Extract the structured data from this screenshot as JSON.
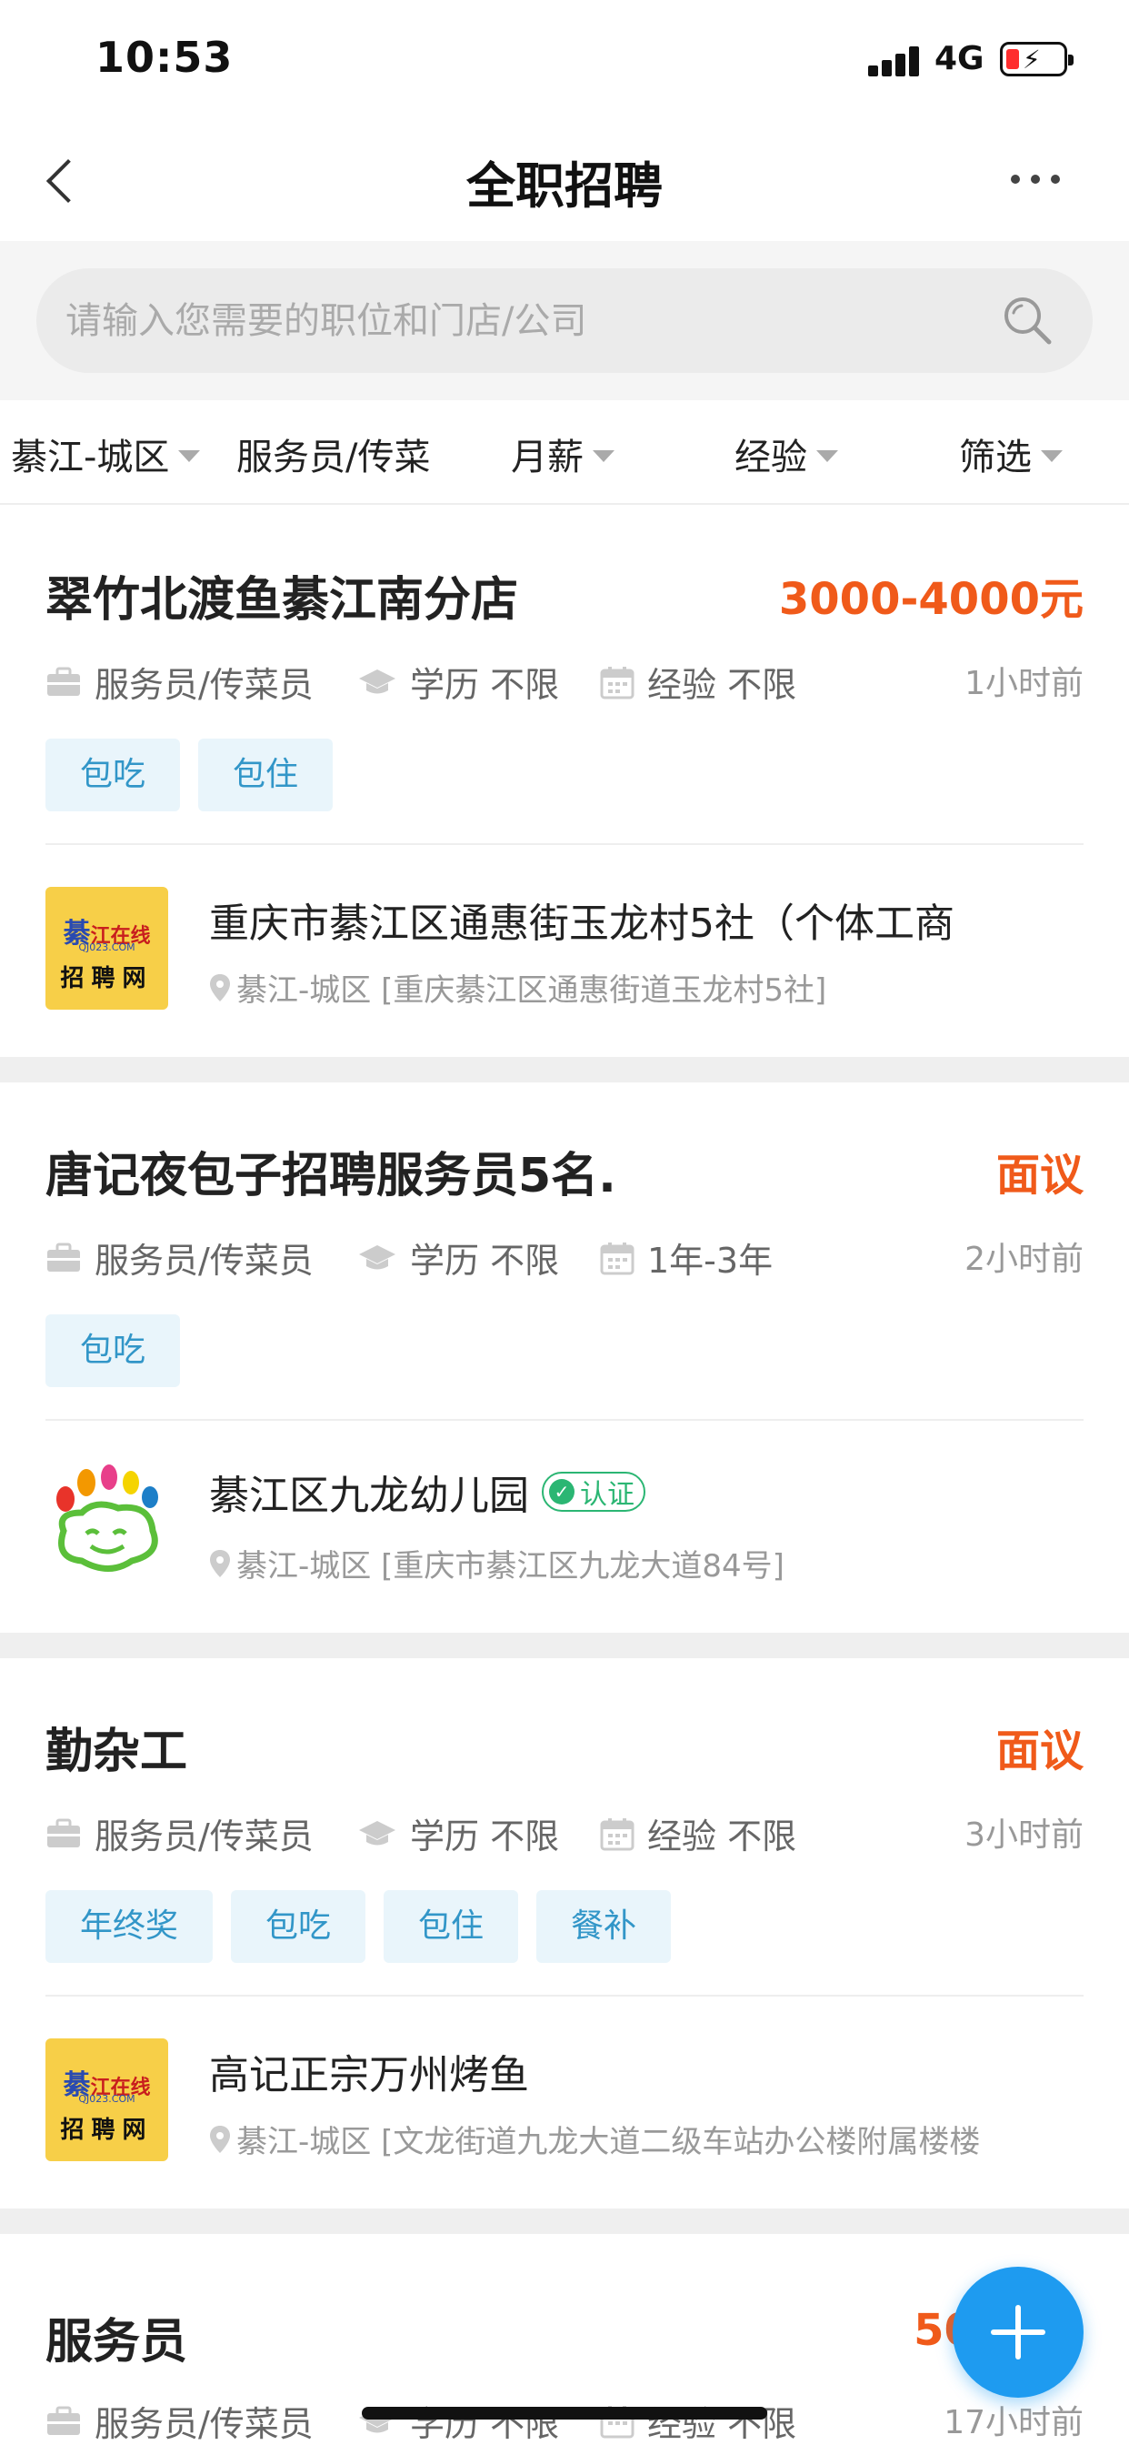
{
  "status_bar": {
    "time": "10:53",
    "network": "4G"
  },
  "nav": {
    "title": "全职招聘"
  },
  "search": {
    "placeholder": "请输入您需要的职位和门店/公司"
  },
  "filters": [
    "綦江-城区",
    "服务员/传菜",
    "月薪",
    "经验",
    "筛选"
  ],
  "jobs": [
    {
      "title": "翠竹北渡鱼綦江南分店",
      "salary": "3000-4000元",
      "category": "服务员/传菜员",
      "education": "学历 不限",
      "experience": "经验 不限",
      "time": "1小时前",
      "tags": [
        "包吃",
        "包住"
      ],
      "company": "重庆市綦江区通惠街玉龙村5社（个体工商",
      "address": "綦江-城区 [重庆綦江区通惠街道玉龙村5社]",
      "logo": "qijiang-recruit-logo"
    },
    {
      "title": "唐记夜包子招聘服务员5名.",
      "salary": "面议",
      "category": "服务员/传菜员",
      "education": "学历 不限",
      "experience": "1年-3年",
      "time": "2小时前",
      "tags": [
        "包吃"
      ],
      "company": "綦江区九龙幼儿园",
      "verified": "认证",
      "address": "綦江-城区 [重庆市綦江区九龙大道84号]",
      "logo": "kindergarten-logo"
    },
    {
      "title": "勤杂工",
      "salary": "面议",
      "category": "服务员/传菜员",
      "education": "学历 不限",
      "experience": "经验 不限",
      "time": "3小时前",
      "tags": [
        "年终奖",
        "包吃",
        "包住",
        "餐补"
      ],
      "company": "高记正宗万州烤鱼",
      "address": "綦江-城区 [文龙街道九龙大道二级车站办公楼附属楼楼",
      "logo": "qijiang-recruit-logo"
    },
    {
      "title": "服务员",
      "salary": "5000-7",
      "category": "服务员/传菜员",
      "education": "学历 不限",
      "experience": "经验 不限",
      "time": "17小时前"
    }
  ],
  "logo_text": {
    "top_char": "綦",
    "top": "江在线",
    "sub": "QJ023.COM",
    "bottom": "招聘网"
  },
  "colors": {
    "salary": "#f05a1a",
    "tag_bg": "#e9f5fb",
    "tag_text": "#3296c8",
    "fab": "#1e9bf0",
    "verified": "#2bb673"
  },
  "icons": [
    "signal-icon",
    "battery-icon",
    "back-icon",
    "more-icon",
    "search-icon",
    "caret-down-icon",
    "briefcase-icon",
    "graduation-cap-icon",
    "calendar-icon",
    "location-pin-icon",
    "verified-check-icon",
    "plus-icon"
  ]
}
